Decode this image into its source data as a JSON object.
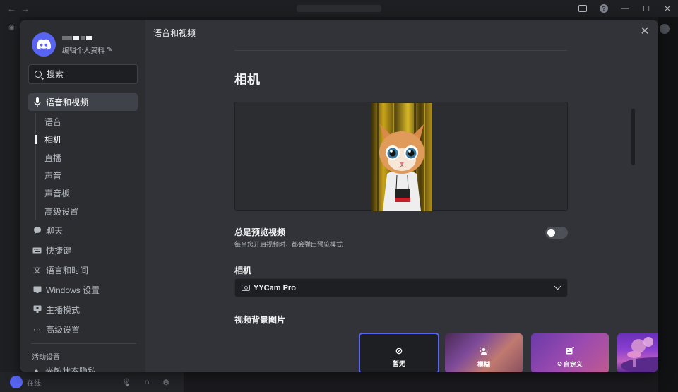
{
  "profile": {
    "edit_label": "编辑个人资料"
  },
  "search": {
    "placeholder": "搜索"
  },
  "nav": {
    "voice_video": "语音和视频",
    "sub_items": [
      "语音",
      "相机",
      "直播",
      "声音",
      "声音板",
      "高级设置"
    ],
    "chat": "聊天",
    "keybinds": "快捷键",
    "language_time": "语言和时间",
    "windows_settings": "Windows 设置",
    "streamer_mode": "主播模式",
    "advanced": "高级设置",
    "activity_section": "活动设置",
    "activity_privacy": "光敏状态隐私"
  },
  "background": {
    "status": "在线"
  },
  "content": {
    "header": "语音和视频",
    "title": "相机",
    "always_preview_title": "总是预览视频",
    "always_preview_desc": "每当您开启视频时，都会弹出预览模式",
    "always_preview_enabled": false,
    "camera_label": "相机",
    "camera_selected": "YYCam Pro",
    "bg_label": "视频背景图片",
    "bg_options": [
      {
        "label": "暂无",
        "icon": "no-entry-icon"
      },
      {
        "label": "模糊",
        "icon": "blur-icon"
      },
      {
        "label": "自定义",
        "icon": "image-plus-icon"
      }
    ]
  },
  "colors": {
    "accent": "#5865f2",
    "sidebar_bg": "#2b2d31",
    "content_bg": "#313338"
  }
}
